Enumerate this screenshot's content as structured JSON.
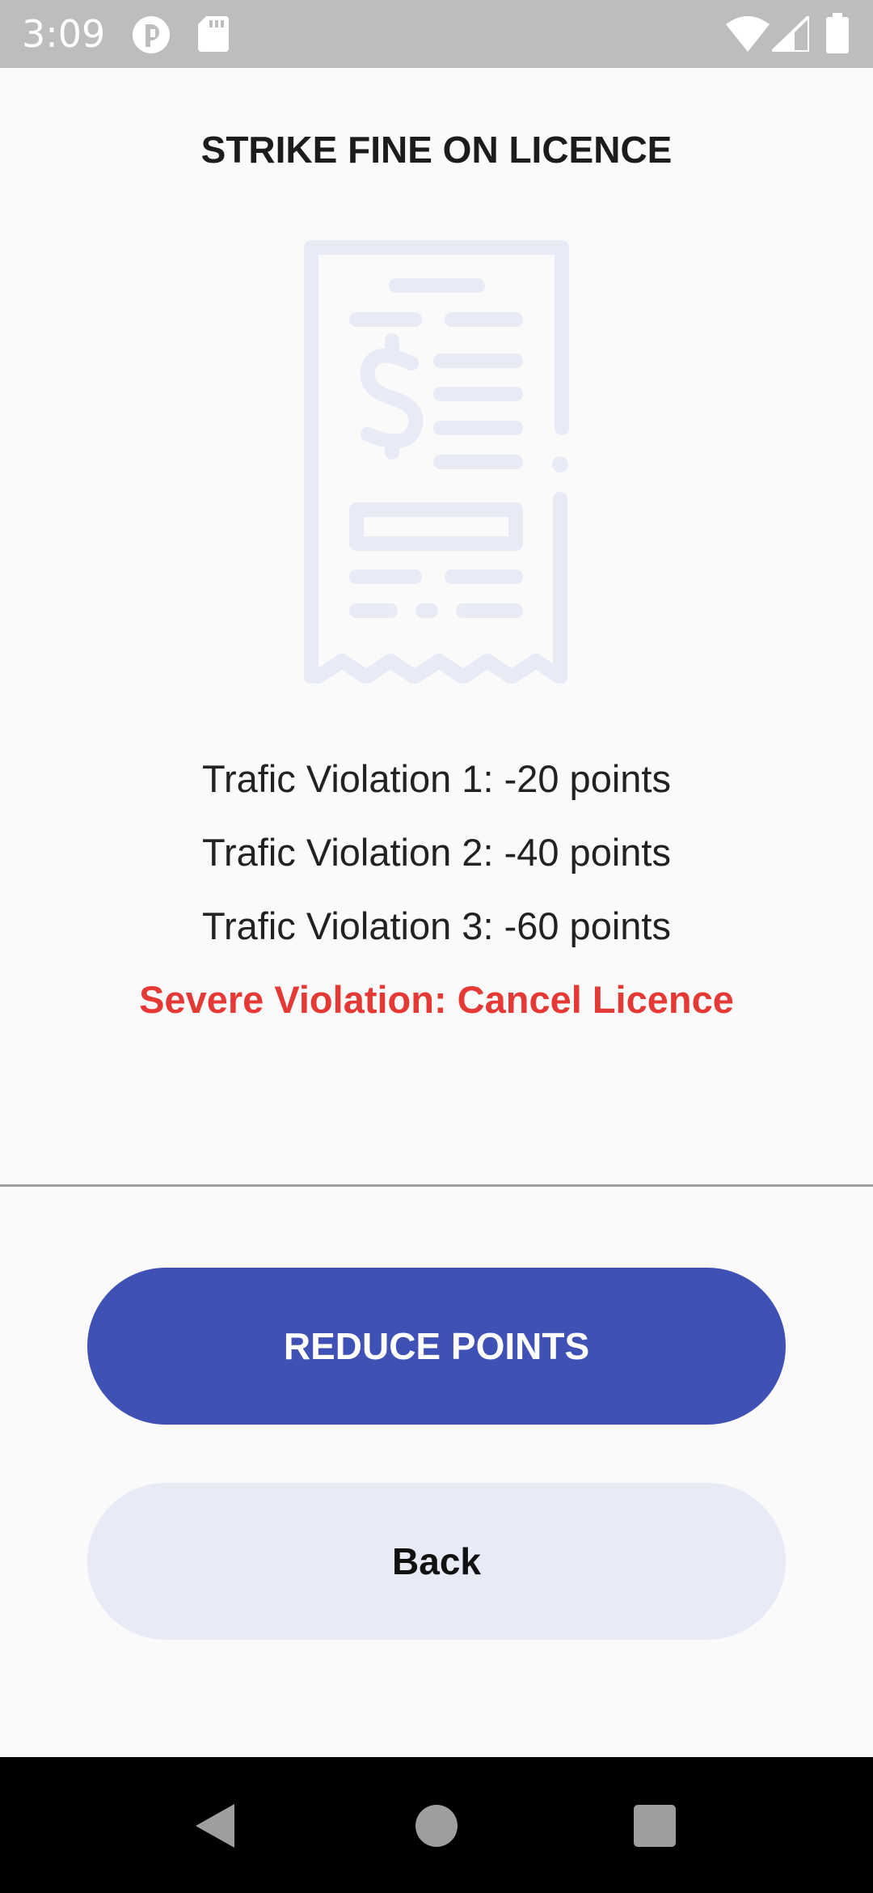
{
  "status_bar": {
    "time": "3:09",
    "icons": [
      "data-saver-icon",
      "sd-card-icon",
      "wifi-icon",
      "cell-signal-icon",
      "battery-icon"
    ]
  },
  "page": {
    "title": "STRIKE FINE ON LICENCE",
    "illustration": "receipt-icon"
  },
  "violations": {
    "items": [
      "Trafic Violation 1: -20 points",
      "Trafic Violation 2: -40 points",
      "Trafic Violation 3: -60 points"
    ],
    "severe": "Severe Violation: Cancel Licence"
  },
  "actions": {
    "reduce_label": "REDUCE POINTS",
    "back_label": "Back"
  },
  "navigation": {
    "buttons": [
      "back-triangle-icon",
      "home-circle-icon",
      "recents-square-icon"
    ]
  },
  "colors": {
    "primary": "#3f51b5",
    "secondary": "#e8eaf6",
    "danger": "#e53935",
    "illustration": "#e8eaf6",
    "status_bar": "#bdbdbd"
  }
}
